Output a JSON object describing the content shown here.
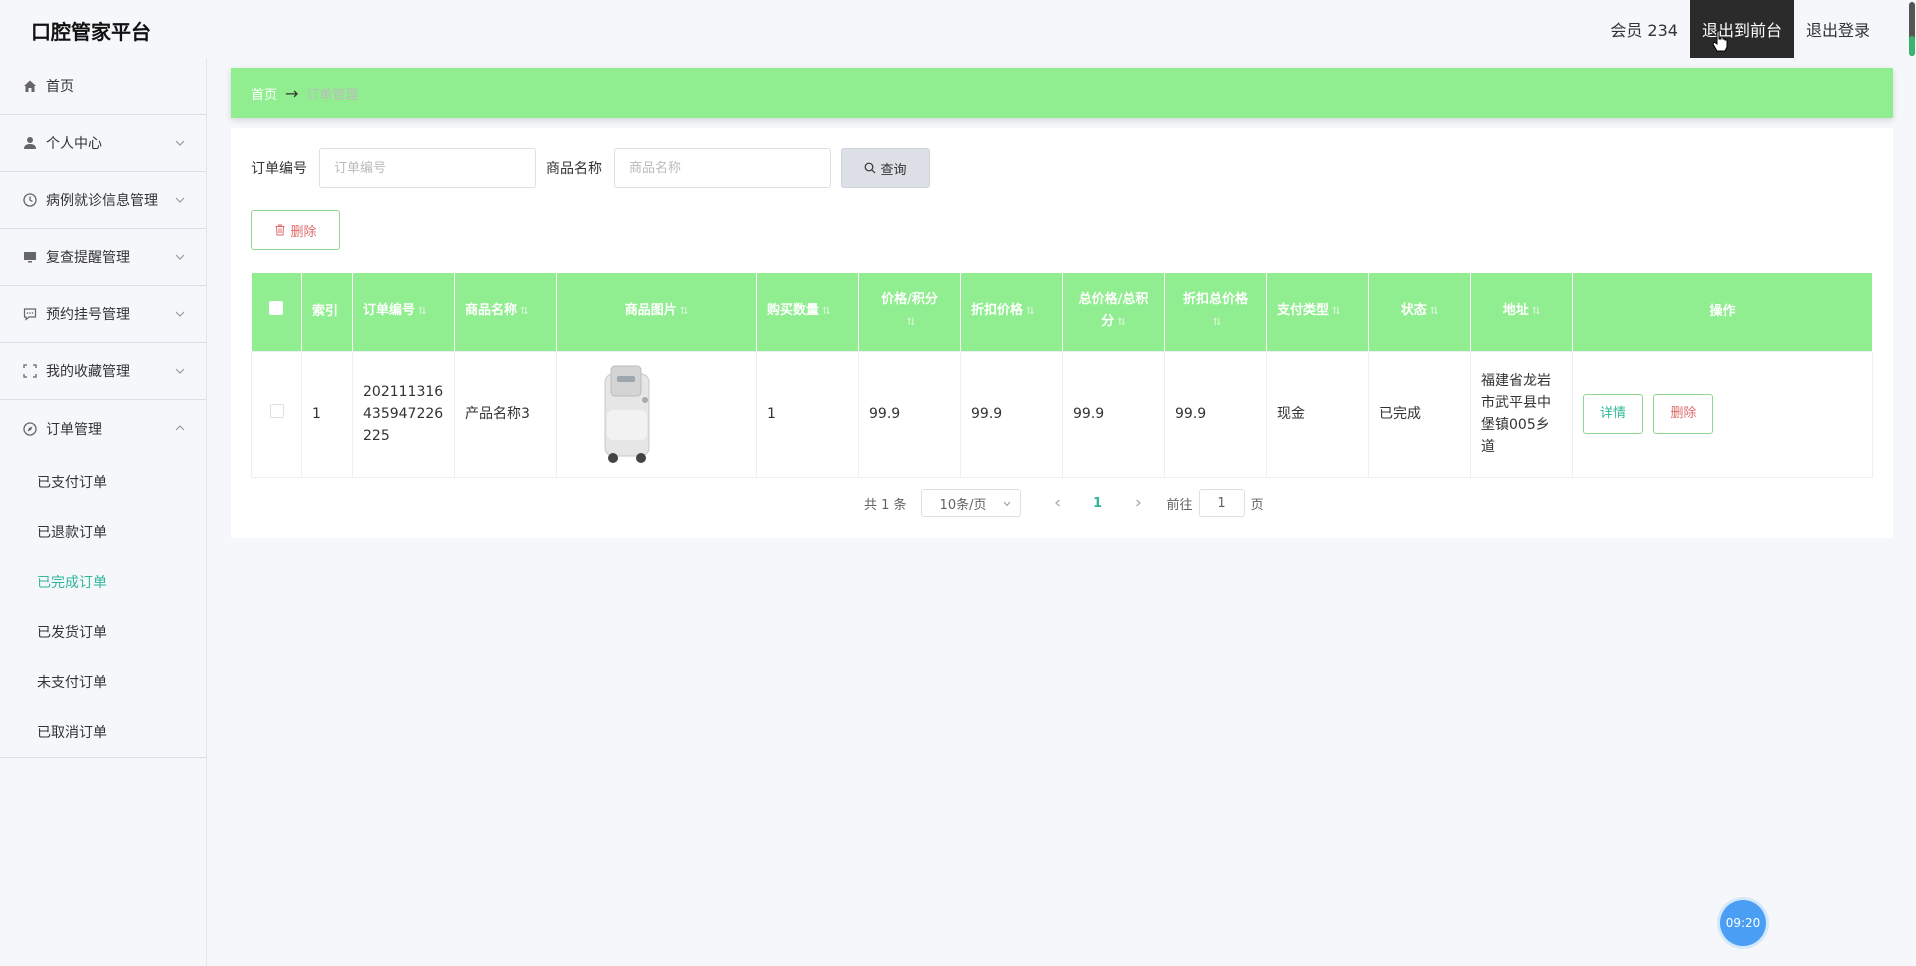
{
  "header": {
    "brand": "口腔管家平台",
    "member": "会员 234",
    "to_front": "退出到前台",
    "logout": "退出登录"
  },
  "sidebar": {
    "items": [
      {
        "label": "首页",
        "icon": "home-icon"
      },
      {
        "label": "个人中心",
        "icon": "user-icon"
      },
      {
        "label": "病例就诊信息管理",
        "icon": "clock-icon"
      },
      {
        "label": "复查提醒管理",
        "icon": "monitor-icon"
      },
      {
        "label": "预约挂号管理",
        "icon": "chat-icon"
      },
      {
        "label": "我的收藏管理",
        "icon": "fullscreen-icon"
      },
      {
        "label": "订单管理",
        "icon": "compass-icon"
      }
    ],
    "order_sub": [
      {
        "label": "已支付订单"
      },
      {
        "label": "已退款订单"
      },
      {
        "label": "已完成订单"
      },
      {
        "label": "已发货订单"
      },
      {
        "label": "未支付订单"
      },
      {
        "label": "已取消订单"
      }
    ],
    "active_sub": "已完成订单"
  },
  "breadcrumb": {
    "home": "首页",
    "sep": "→",
    "current": "订单管理"
  },
  "search": {
    "order_no_label": "订单编号",
    "order_no_placeholder": "订单编号",
    "product_label": "商品名称",
    "product_placeholder": "商品名称",
    "query_label": "查询"
  },
  "actions": {
    "delete_label": "删除"
  },
  "table": {
    "headers": [
      "索引",
      "订单编号",
      "商品名称",
      "商品图片",
      "购买数量",
      "价格/积分",
      "折扣价格",
      "总价格/总积分",
      "折扣总价格",
      "支付类型",
      "状态",
      "地址",
      "操作"
    ],
    "rows": [
      {
        "index": "1",
        "order_no": "202111316435947226225",
        "product_name": "产品名称3",
        "quantity": "1",
        "price": "99.9",
        "discount_price": "99.9",
        "total_price": "99.9",
        "discount_total": "99.9",
        "pay_type": "现金",
        "status": "已完成",
        "address": "福建省龙岩市武平县中堡镇005乡道",
        "detail_label": "详情",
        "delete_label": "删除"
      }
    ]
  },
  "pagination": {
    "total": "共 1 条",
    "page_size": "10条/页",
    "current_page": "1",
    "goto_label": "前往",
    "goto_value": "1",
    "page_suffix": "页"
  },
  "clock": "09:20",
  "colors": {
    "accent_green": "#90ee90",
    "active_text": "#2fb79a",
    "danger": "#e06a6a"
  }
}
